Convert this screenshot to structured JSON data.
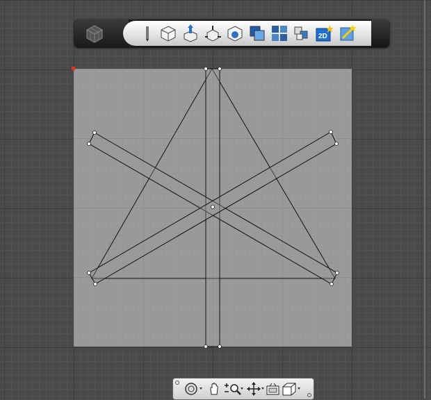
{
  "toolbar": {
    "tools": [
      "home-view-icon",
      "sketch-pencil-icon",
      "box-icon",
      "extrude-icon",
      "tweak-icon",
      "shell-icon",
      "combine-icon",
      "pattern-icon",
      "grouping-icon",
      "2d-view-icon",
      "snap-magic-icon"
    ],
    "icons": {
      "twod_label": "2D"
    }
  },
  "canvas": {
    "fill": "#9a9a9a",
    "line": "#111111"
  },
  "navbar": {
    "tools": [
      "orbit-icon",
      "pan-hand-icon",
      "zoom-icon",
      "fit-icon",
      "view-camera-icon",
      "view-cube-icon"
    ]
  }
}
